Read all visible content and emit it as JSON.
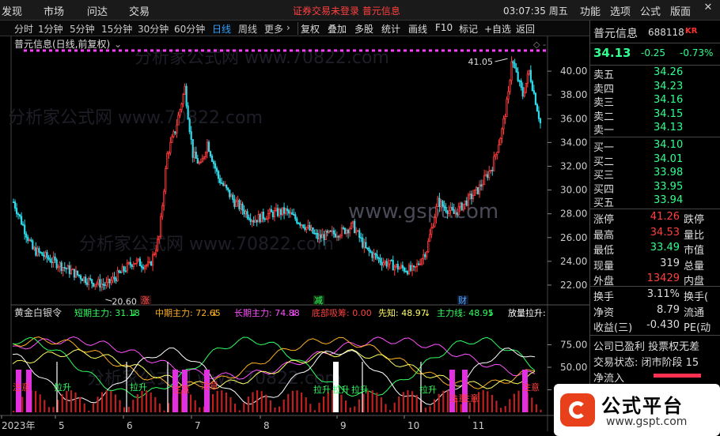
{
  "menu": {
    "items": [
      "发现",
      "市场",
      "问达",
      "交易"
    ],
    "status": "证券交易未登录   普元信息",
    "clock": "03:07:35 周五",
    "right_items": [
      "功能",
      "选项",
      "公式",
      "版面"
    ],
    "window_controls": [
      "minimize-icon",
      "close-icon"
    ]
  },
  "toolbar": {
    "periods": [
      "分时",
      "1分钟",
      "5分钟",
      "15分钟",
      "30分钟",
      "60分钟",
      "日线",
      "周线",
      "更多"
    ],
    "active_period": "日线",
    "tools": [
      "复权",
      "叠加",
      "多股",
      "统计",
      "画线",
      "F10",
      "标记",
      "+自选",
      "返回"
    ]
  },
  "chart": {
    "title": "普元信息(日线,前复权)",
    "watermark_1": "分析家公式网 www.70822.com",
    "watermark_2": "www.gspt.com",
    "price_axis": [
      "40.00",
      "38.00",
      "36.00",
      "34.00",
      "32.00",
      "30.00",
      "28.00",
      "26.00",
      "24.00",
      "22.00"
    ],
    "price_range": [
      21.0,
      41.6
    ],
    "high_label": "41.05",
    "low_label": "20.60",
    "events": [
      {
        "label": "涨",
        "color": "#ff5050"
      },
      {
        "label": "减",
        "color": "#30ff60"
      },
      {
        "label": "财",
        "color": "#4fa8ff"
      }
    ],
    "date_axis": [
      "2023年",
      "5",
      "6",
      "7",
      "8",
      "9",
      "10",
      "11"
    ],
    "colors": {
      "up": "#ff3c3c",
      "down": "#30d8e8",
      "text": "#cccccc"
    }
  },
  "indicator": {
    "name": "黄金白银令",
    "legend": [
      {
        "text": "短期主力: 31.18",
        "arrow": "↓",
        "color": "#30ff60"
      },
      {
        "text": "中期主力: 72.65",
        "arrow": "↓",
        "color": "#ffb020"
      },
      {
        "text": "长期主力: 74.88",
        "arrow": "↓",
        "color": "#ff50ff"
      },
      {
        "text": "底部吸筹: 0.00",
        "arrow": "",
        "color": "#ff4040"
      },
      {
        "text": "先知: 48.97",
        "arrow": "↓",
        "color": "#ffff60"
      },
      {
        "text": "主力线: 48.95",
        "arrow": "↓",
        "color": "#30ff60"
      },
      {
        "text": "放量拉升:",
        "arrow": "",
        "color": "#ffffff"
      }
    ],
    "axis": [
      "75.00",
      "50.00",
      "25.00"
    ],
    "axis_range": [
      0,
      100
    ],
    "labels_attention": "注意",
    "labels_up": "拉升"
  },
  "quote": {
    "name": "普元信息",
    "code": "688118",
    "tag": "KR",
    "price": "34.13",
    "change": "-0.25",
    "change_pct": "-0.73%",
    "asks": [
      {
        "label": "卖五",
        "value": "34.26"
      },
      {
        "label": "卖四",
        "value": "34.23"
      },
      {
        "label": "卖三",
        "value": "34.16"
      },
      {
        "label": "卖二",
        "value": "34.15"
      },
      {
        "label": "卖一",
        "value": "34.13"
      }
    ],
    "bids": [
      {
        "label": "买一",
        "value": "34.10"
      },
      {
        "label": "买二",
        "value": "34.01"
      },
      {
        "label": "买三",
        "value": "33.98"
      },
      {
        "label": "买四",
        "value": "33.95"
      },
      {
        "label": "买五",
        "value": "33.94"
      }
    ],
    "stats": [
      {
        "label": "涨停",
        "value": "41.26",
        "label2": "跌停",
        "color": "#ff4040"
      },
      {
        "label": "最高",
        "value": "34.53",
        "label2": "量比",
        "color": "#ff4040"
      },
      {
        "label": "最低",
        "value": "33.49",
        "label2": "市值",
        "color": "#30ff90"
      },
      {
        "label": "现量",
        "value": "319",
        "label2": "总量",
        "color": "#dddddd"
      },
      {
        "label": "外盘",
        "value": "13429",
        "label2": "内盘",
        "color": "#ff4040"
      }
    ],
    "stats2": [
      {
        "label": "换手",
        "value": "3.11%",
        "label2": "换手(",
        "color": "#dddddd"
      },
      {
        "label": "净资",
        "value": "8.79",
        "label2": "流通",
        "color": "#dddddd"
      },
      {
        "label": "收益(三)",
        "value": "-0.430",
        "label2": "PE(动",
        "color": "#dddddd"
      }
    ],
    "info1": "公司已盈利 投票权无差",
    "info2": "交易状态: 闭市阶段 15",
    "net_inflow_label": "净流入"
  },
  "logo": {
    "title": "公式平台",
    "url": "www.gspt.com"
  }
}
